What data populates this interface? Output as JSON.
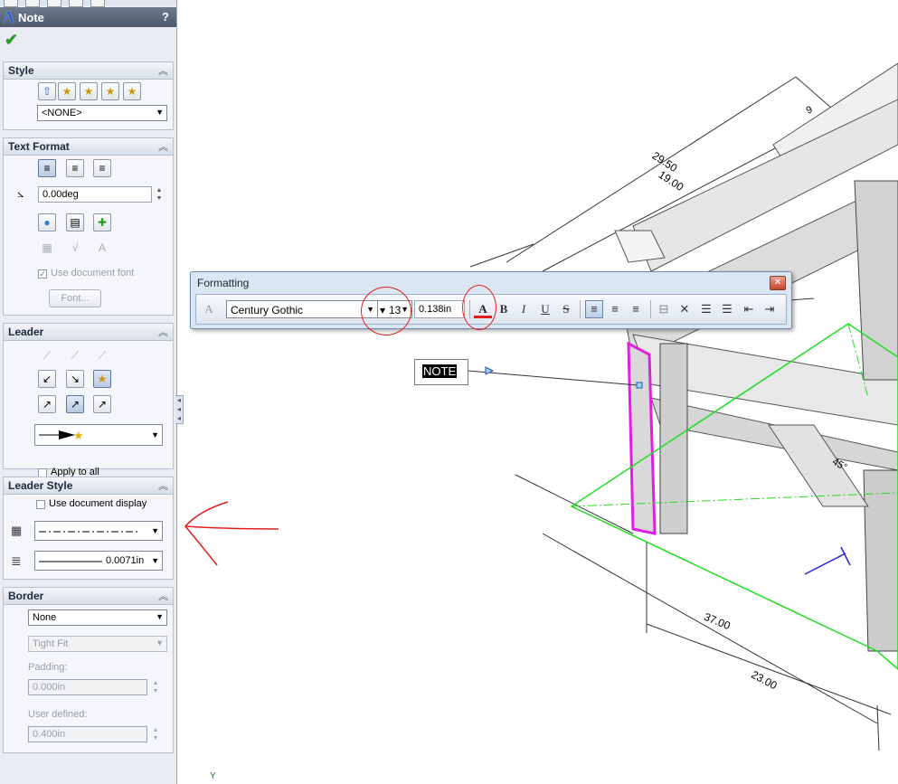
{
  "panel": {
    "title": "Note",
    "help": "?",
    "style": {
      "title": "Style",
      "dropdown_value": "<NONE>"
    },
    "text_format": {
      "title": "Text Format",
      "angle_value": "0.00deg",
      "use_doc_font_label": "Use document font",
      "font_button_label": "Font..."
    },
    "leader": {
      "title": "Leader",
      "apply_to_all_label": "Apply to all"
    },
    "leader_style": {
      "title": "Leader Style",
      "use_doc_display_label": "Use document display",
      "thickness_value": "0.0071in"
    },
    "border": {
      "title": "Border",
      "style_value": "None",
      "size_value": "Tight Fit",
      "padding_label": "Padding:",
      "padding_value": "0.000in",
      "user_defined_label": "User defined:",
      "user_defined_value": "0.400in"
    }
  },
  "formatting": {
    "title": "Formatting",
    "font_name": "Century Gothic",
    "font_size": "13",
    "height_value": "0.138in",
    "bold": "B",
    "italic": "I",
    "underline": "U",
    "strike": "S"
  },
  "note_text": "NOTE",
  "dimensions": [
    "29.50",
    "19.00",
    "37.00",
    "23.00",
    "45°",
    "9"
  ],
  "axis_label": "Y",
  "colors": {
    "selection": "#e020e0",
    "sketch": "#22dd22",
    "annotation_red": "#e02020",
    "panel_bg": "#e9edf3"
  }
}
